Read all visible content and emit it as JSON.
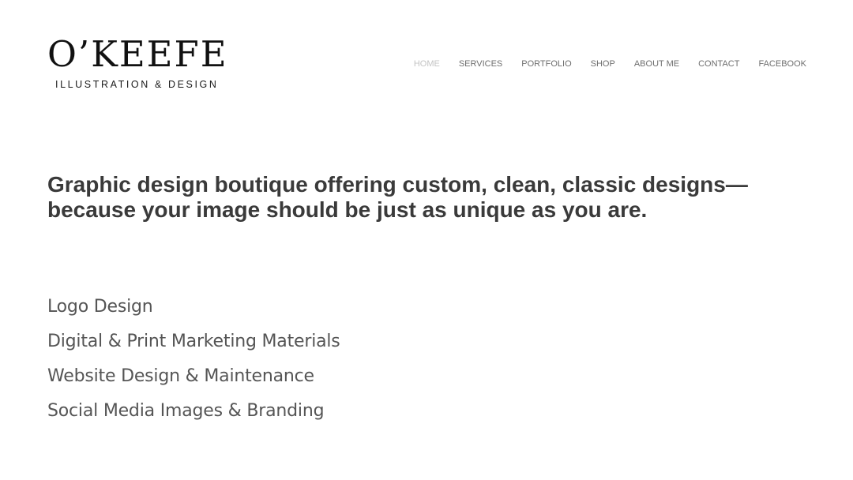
{
  "brand": {
    "name": "O’KEEFE",
    "tagline": "ILLUSTRATION & DESIGN"
  },
  "nav": {
    "items": [
      {
        "label": "HOME",
        "active": true
      },
      {
        "label": "SERVICES",
        "active": false
      },
      {
        "label": "PORTFOLIO",
        "active": false
      },
      {
        "label": "SHOP",
        "active": false
      },
      {
        "label": "ABOUT ME",
        "active": false
      },
      {
        "label": "CONTACT",
        "active": false
      },
      {
        "label": "FACEBOOK",
        "active": false
      }
    ]
  },
  "hero": {
    "line1": "Graphic design boutique offering custom, clean, classic designs—",
    "line2": "because your image should be just as unique as you are."
  },
  "services": {
    "items": [
      "Logo Design",
      "Digital & Print Marketing Materials",
      "Website Design & Maintenance",
      "Social Media Images & Branding"
    ]
  },
  "colors": {
    "background": "#ffffff",
    "nav_text": "#6e6e6e",
    "nav_active": "#c4c4c4",
    "heading_text": "#3a3a3a",
    "body_text": "#555555"
  }
}
